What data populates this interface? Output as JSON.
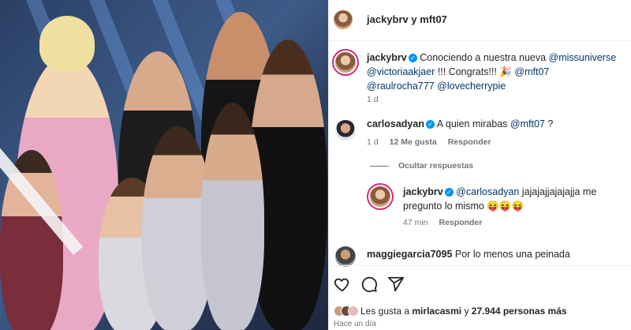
{
  "post": {
    "header": {
      "username": "jackybrv",
      "joiner": " y ",
      "collaborator": "mft07"
    },
    "caption": {
      "username": "jackybrv",
      "text": "Conociendo a nuestra nueva",
      "mention1": "@missuniverse",
      "mention2": "@victoriaakjaer",
      "text2": "!!! Congrats!!!",
      "emoji": "🎉",
      "mention3": "@mft07",
      "mention4": "@raulrocha777",
      "mention5": "@lovecherrypie",
      "time": "1 d"
    }
  },
  "comments": [
    {
      "username": "carlosadyan",
      "text": "A quien mirabas",
      "mention": "@mft07",
      "tail": " ?",
      "time": "1 d",
      "likes": "12 Me gusta",
      "reply": "Responder"
    }
  ],
  "replies_toggle": "Ocultar respuestas",
  "reply": {
    "username": "jackybrv",
    "mention": "@carlosadyan",
    "text": "jajajajjajajajja me pregunto lo mismo",
    "emojis": "😝😝😝",
    "time": "47 min",
    "reply_label": "Responder"
  },
  "comment2": {
    "username": "maggiegarcia7095",
    "text": "Por lo menos una peinada"
  },
  "likes": {
    "prefix": "Les gusta a",
    "user": "mirlacasmi",
    "middle": "y",
    "count": "27.944 personas más"
  },
  "timestamp": "Hace un día",
  "icons": [
    "heart-icon",
    "comment-icon",
    "share-icon"
  ],
  "colors": {
    "link": "#00376b",
    "verified": "#0095f6",
    "muted": "#737373"
  }
}
